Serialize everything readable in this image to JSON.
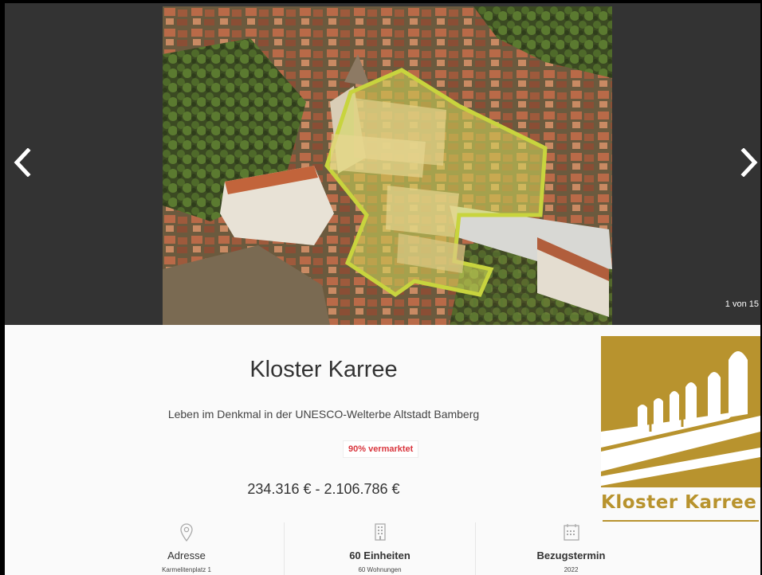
{
  "gallery": {
    "counter": "1 von 15",
    "prev_icon": "chevron-left-icon",
    "next_icon": "chevron-right-icon"
  },
  "project": {
    "title": "Kloster Karree",
    "subtitle": "Leben im Denkmal in der UNESCO-Welterbe Altstadt Bamberg",
    "status_badge": "90% vermarktet",
    "price_range": "234.316 € - 2.106.786 €"
  },
  "logo": {
    "text": "Kloster Karree",
    "color": "#b8932e"
  },
  "features": [
    {
      "icon": "location-pin-icon",
      "label": "Adresse",
      "value": "Karmelitenplatz 1"
    },
    {
      "icon": "building-icon",
      "label": "60 Einheiten",
      "value": "60 Wohnungen"
    },
    {
      "icon": "calendar-icon",
      "label": "Bezugstermin",
      "value": "2022"
    }
  ],
  "colors": {
    "gallery_bg": "#333333",
    "badge_text": "#d9363e",
    "highlight_overlay": "#d6dd5a"
  }
}
